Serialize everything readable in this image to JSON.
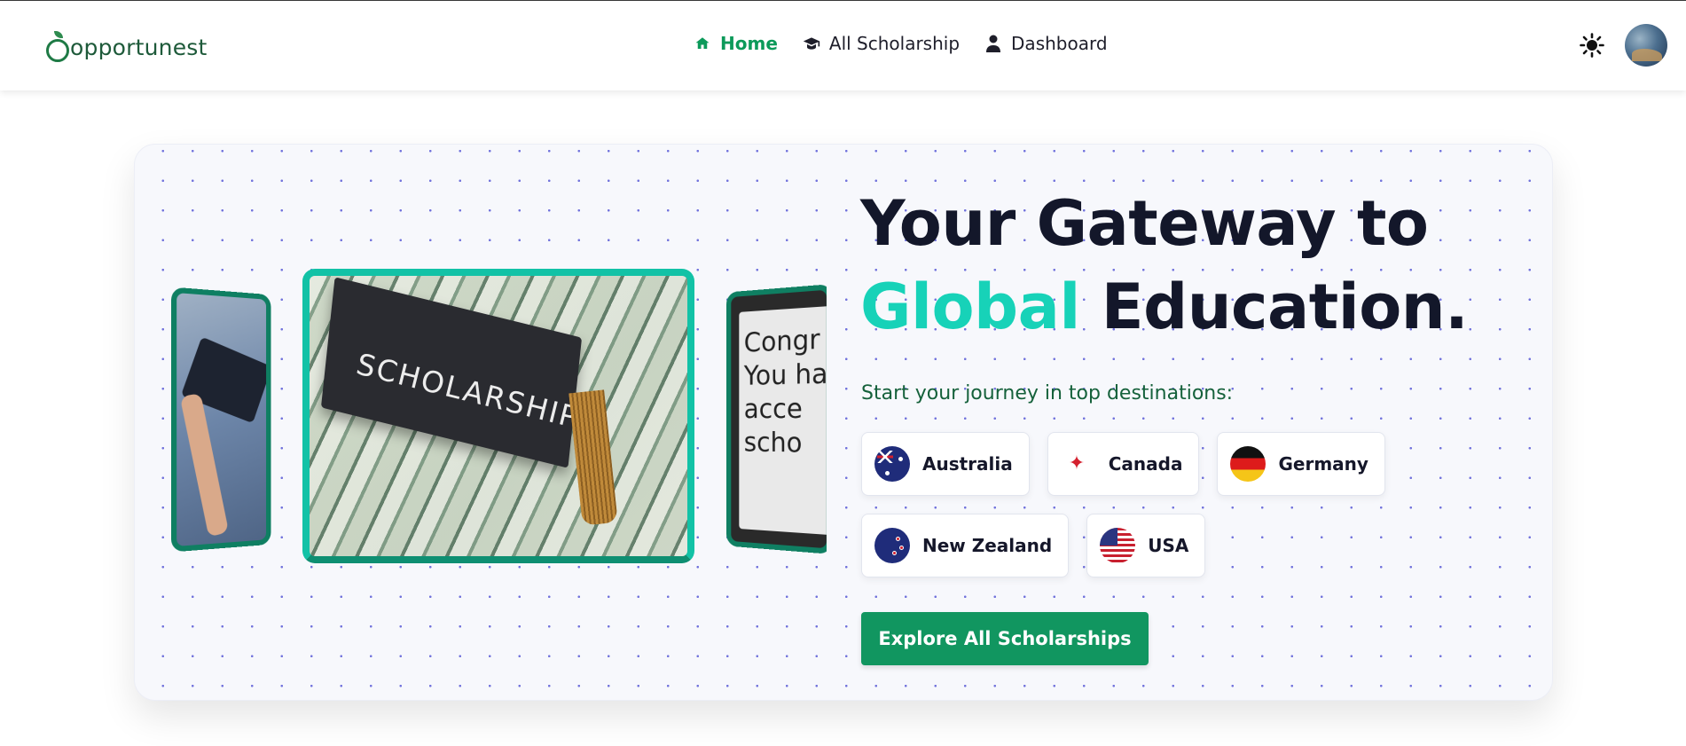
{
  "brand": {
    "name": "opportunest"
  },
  "nav": {
    "items": [
      {
        "label": "Home",
        "icon": "home-icon",
        "active": true
      },
      {
        "label": "All Scholarship",
        "icon": "graduation-cap-icon",
        "active": false
      },
      {
        "label": "Dashboard",
        "icon": "user-icon",
        "active": false
      }
    ]
  },
  "carousel": {
    "center_caption": "SCHOLARSHIP",
    "right_caption": "Congr You ha acce scho"
  },
  "hero": {
    "title_line1": "Your Gateway to",
    "title_accent": "Global",
    "title_line2_rest": "Education.",
    "subtitle": "Start your journey in top destinations:",
    "destinations": [
      {
        "name": "Australia",
        "flag": "australia-flag-icon"
      },
      {
        "name": "Canada",
        "flag": "canada-flag-icon"
      },
      {
        "name": "Germany",
        "flag": "germany-flag-icon"
      },
      {
        "name": "New Zealand",
        "flag": "new-zealand-flag-icon"
      },
      {
        "name": "USA",
        "flag": "usa-flag-icon"
      }
    ],
    "cta_label": "Explore All Scholarships"
  },
  "colors": {
    "brand_green": "#119660",
    "accent_teal": "#17d2b8",
    "title_dark": "#13172a",
    "active_nav": "#0c9a5a"
  }
}
